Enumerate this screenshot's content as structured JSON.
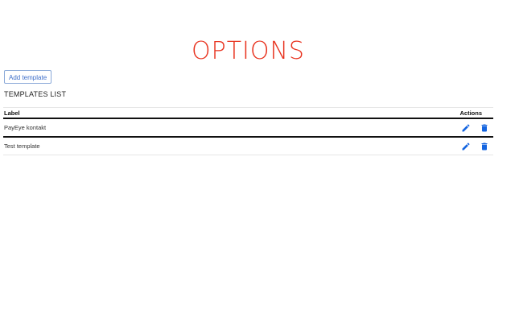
{
  "header": {
    "title": "OPTIONS"
  },
  "toolbar": {
    "add_label": "Add template"
  },
  "templates": {
    "section_title": "TEMPLATES LIST",
    "columns": {
      "label": "Label",
      "actions": "Actions"
    },
    "rows": [
      {
        "label": "PayEye kontakt"
      },
      {
        "label": "Test template"
      }
    ]
  },
  "colors": {
    "title": "#e8321e",
    "accent": "#1565e0",
    "button_border": "#8aa9d8"
  },
  "icons": {
    "edit": "pencil-icon",
    "delete": "trash-icon"
  }
}
